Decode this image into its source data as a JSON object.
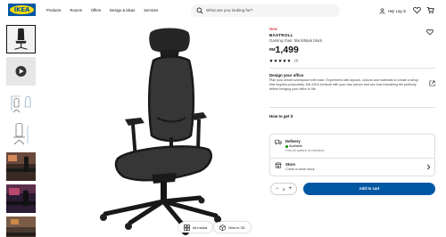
{
  "colors": {
    "brand_blue": "#0058a3",
    "brand_yellow": "#ffdb00",
    "new_badge": "#cc0008",
    "available": "#0a8a00"
  },
  "header": {
    "logo_text": "IKEA",
    "nav": [
      "Products",
      "Rooms",
      "Offers",
      "Design & ideas",
      "Services"
    ],
    "search": {
      "placeholder": "What are you looking for?",
      "icon": "search-icon"
    },
    "login_label": "Hej! Log in",
    "icons": [
      "user-icon",
      "heart-icon",
      "cart-icon"
    ]
  },
  "thumbnails": {
    "count": 7,
    "items": [
      "chair-front",
      "video-play",
      "dimensions-drawing",
      "dimensions-drawing-2",
      "room-photo-1",
      "room-photo-2",
      "room-photo-3"
    ]
  },
  "image_buttons": {
    "all_media": "All media",
    "view_3d": "View in 3D"
  },
  "product": {
    "badge": "New",
    "name": "BASTROLL",
    "description": "Gaming chair, black/Mjuk black",
    "currency": "RM",
    "price": "1,499",
    "rating_stars": 5,
    "review_count": "(3)"
  },
  "design": {
    "title": "Design your office",
    "text": "Plan your dream workspace with ease. Experiment with layouts, colours and materials to create a setup that inspires productivity. Mix IKEA furniture with your own pieces and see how everything fits perfectly before bringing your office to life."
  },
  "how_to_get": {
    "title": "How to get it",
    "delivery": {
      "title": "Delivery",
      "status": "Available",
      "note": "Find all options at checkout"
    },
    "store": {
      "title": "Store",
      "note": "Check in-store stock"
    }
  },
  "cart": {
    "quantity": "1",
    "minus": "−",
    "plus": "+",
    "add_label": "Add to cart"
  }
}
